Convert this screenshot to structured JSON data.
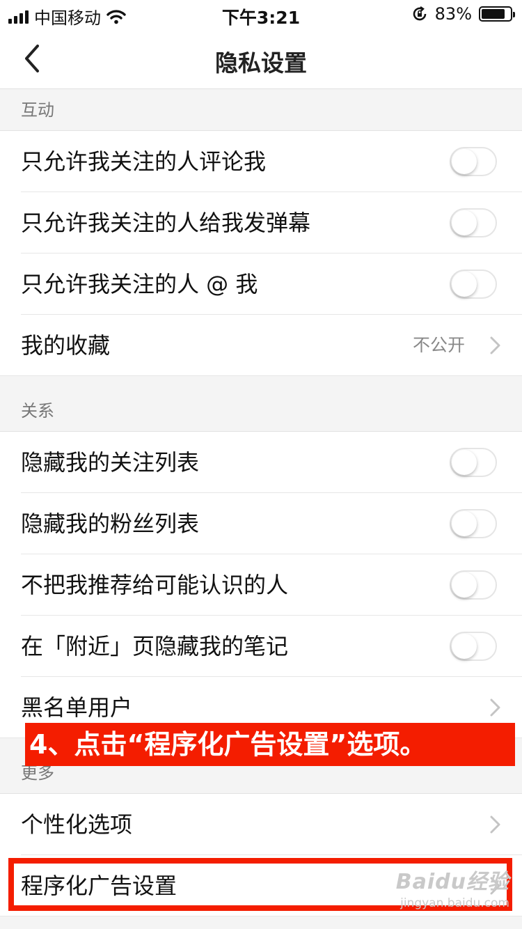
{
  "status_bar": {
    "carrier": "中国移动",
    "time": "下午3:21",
    "battery": "83%",
    "battery_level": 0.83
  },
  "nav": {
    "title": "隐私设置"
  },
  "sections": {
    "interaction": {
      "header": "互动",
      "items": [
        {
          "label": "只允许我关注的人评论我",
          "toggle": false
        },
        {
          "label": "只允许我关注的人给我发弹幕",
          "toggle": false
        },
        {
          "label": "只允许我关注的人 @ 我",
          "toggle": false
        },
        {
          "label": "我的收藏",
          "value": "不公开"
        }
      ]
    },
    "relations": {
      "header": "关系",
      "items": [
        {
          "label": "隐藏我的关注列表",
          "toggle": false
        },
        {
          "label": "隐藏我的粉丝列表",
          "toggle": false
        },
        {
          "label": "不把我推荐给可能认识的人",
          "toggle": false
        },
        {
          "label": "在「附近」页隐藏我的笔记",
          "toggle": false
        },
        {
          "label": "黑名单用户"
        }
      ]
    },
    "more": {
      "header": "更多",
      "items": [
        {
          "label": "个性化选项"
        },
        {
          "label": "程序化广告设置"
        }
      ]
    }
  },
  "overlay": {
    "instruction": "4、点击“程序化广告设置”选项。",
    "accent_color": "#f41d00"
  },
  "watermark": {
    "logo": "Baidu经验",
    "url": "jingyan.baidu.com"
  }
}
